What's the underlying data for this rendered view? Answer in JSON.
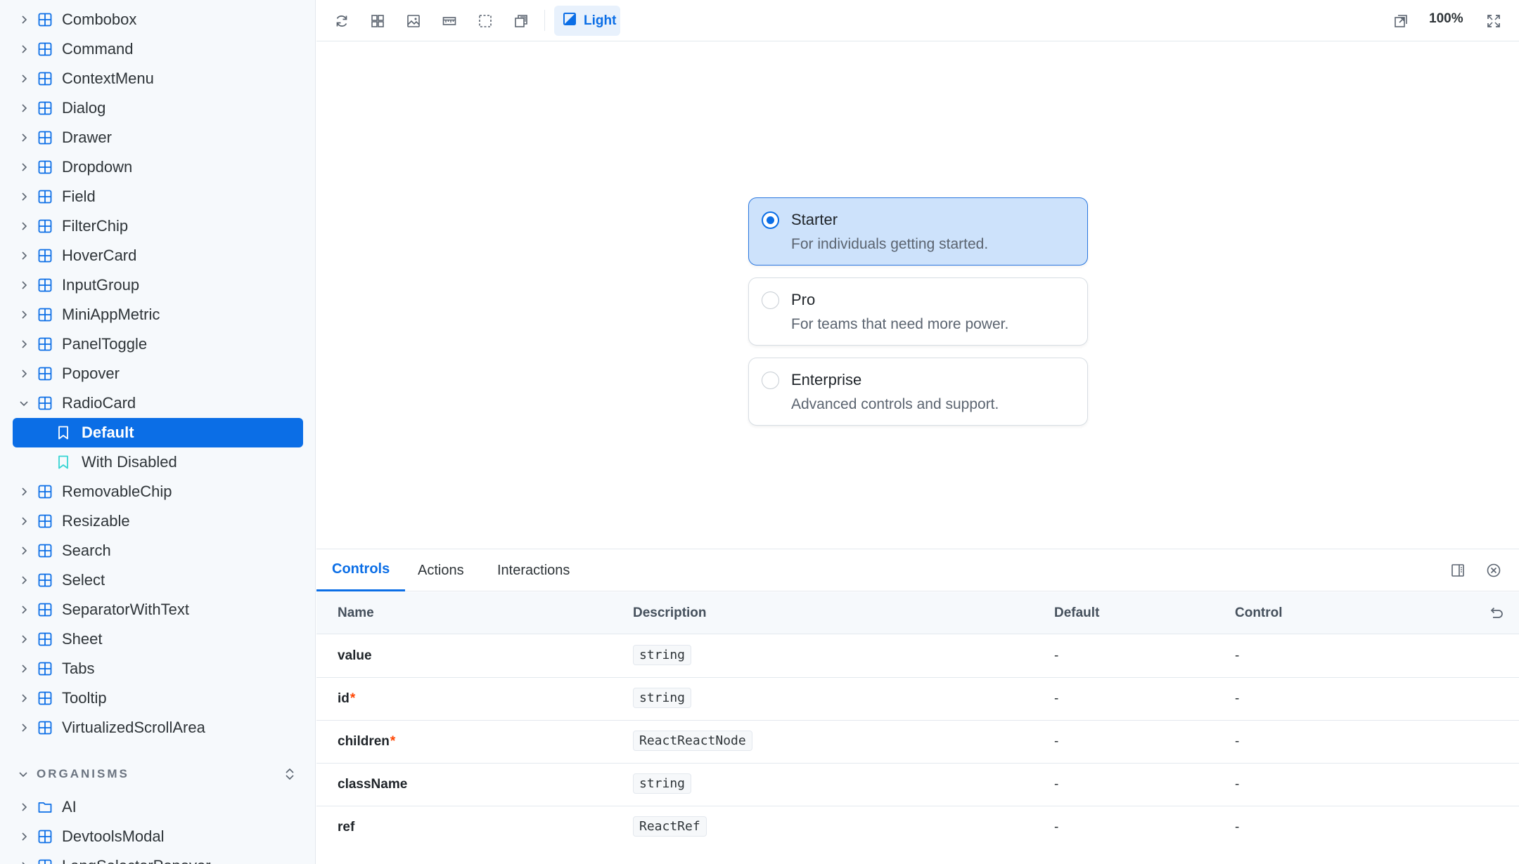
{
  "sidebar": {
    "items": [
      {
        "label": "Combobox"
      },
      {
        "label": "Command"
      },
      {
        "label": "ContextMenu"
      },
      {
        "label": "Dialog"
      },
      {
        "label": "Drawer"
      },
      {
        "label": "Dropdown"
      },
      {
        "label": "Field"
      },
      {
        "label": "FilterChip"
      },
      {
        "label": "HoverCard"
      },
      {
        "label": "InputGroup"
      },
      {
        "label": "MiniAppMetric"
      },
      {
        "label": "PanelToggle"
      },
      {
        "label": "Popover"
      },
      {
        "label": "RadioCard"
      },
      {
        "label": "Default"
      },
      {
        "label": "With Disabled"
      },
      {
        "label": "RemovableChip"
      },
      {
        "label": "Resizable"
      },
      {
        "label": "Search"
      },
      {
        "label": "Select"
      },
      {
        "label": "SeparatorWithText"
      },
      {
        "label": "Sheet"
      },
      {
        "label": "Tabs"
      },
      {
        "label": "Tooltip"
      },
      {
        "label": "VirtualizedScrollArea"
      }
    ],
    "section_label": "ORGANISMS",
    "organisms": [
      {
        "label": "AI"
      },
      {
        "label": "DevtoolsModal"
      },
      {
        "label": "LangSelectorPopover"
      }
    ]
  },
  "toolbar": {
    "theme_label": "Light",
    "zoom": "100%"
  },
  "preview": {
    "options": [
      {
        "title": "Starter",
        "description": "For individuals getting started.",
        "checked": true
      },
      {
        "title": "Pro",
        "description": "For teams that need more power.",
        "checked": false
      },
      {
        "title": "Enterprise",
        "description": "Advanced controls and support.",
        "checked": false
      }
    ]
  },
  "panel": {
    "tabs": [
      {
        "label": "Controls"
      },
      {
        "label": "Actions"
      },
      {
        "label": "Interactions"
      }
    ],
    "columns": {
      "name": "Name",
      "description": "Description",
      "default": "Default",
      "control": "Control"
    },
    "rows": [
      {
        "name": "value",
        "required": "",
        "type": "string",
        "default": "-",
        "control": "-"
      },
      {
        "name": "id",
        "required": "*",
        "type": "string",
        "default": "-",
        "control": "-"
      },
      {
        "name": "children",
        "required": "*",
        "type": "ReactReactNode",
        "default": "-",
        "control": "-"
      },
      {
        "name": "className",
        "required": "",
        "type": "string",
        "default": "-",
        "control": "-"
      },
      {
        "name": "ref",
        "required": "",
        "type": "ReactRef",
        "default": "-",
        "control": "-"
      }
    ]
  },
  "colors": {
    "accent": "#0b6ee6",
    "selected_card_bg": "#cde2fb",
    "required_marker": "#ff4400",
    "story_icon": "#37d5d3"
  }
}
